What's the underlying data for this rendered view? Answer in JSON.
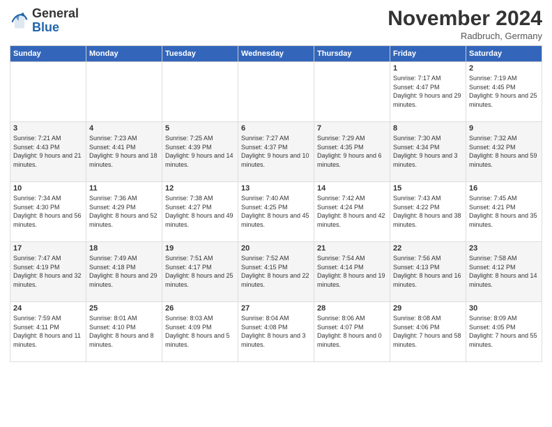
{
  "header": {
    "logo_general": "General",
    "logo_blue": "Blue",
    "title": "November 2024",
    "location": "Radbruch, Germany"
  },
  "days_of_week": [
    "Sunday",
    "Monday",
    "Tuesday",
    "Wednesday",
    "Thursday",
    "Friday",
    "Saturday"
  ],
  "weeks": [
    [
      {
        "day": "",
        "info": ""
      },
      {
        "day": "",
        "info": ""
      },
      {
        "day": "",
        "info": ""
      },
      {
        "day": "",
        "info": ""
      },
      {
        "day": "",
        "info": ""
      },
      {
        "day": "1",
        "info": "Sunrise: 7:17 AM\nSunset: 4:47 PM\nDaylight: 9 hours and 29 minutes."
      },
      {
        "day": "2",
        "info": "Sunrise: 7:19 AM\nSunset: 4:45 PM\nDaylight: 9 hours and 25 minutes."
      }
    ],
    [
      {
        "day": "3",
        "info": "Sunrise: 7:21 AM\nSunset: 4:43 PM\nDaylight: 9 hours and 21 minutes."
      },
      {
        "day": "4",
        "info": "Sunrise: 7:23 AM\nSunset: 4:41 PM\nDaylight: 9 hours and 18 minutes."
      },
      {
        "day": "5",
        "info": "Sunrise: 7:25 AM\nSunset: 4:39 PM\nDaylight: 9 hours and 14 minutes."
      },
      {
        "day": "6",
        "info": "Sunrise: 7:27 AM\nSunset: 4:37 PM\nDaylight: 9 hours and 10 minutes."
      },
      {
        "day": "7",
        "info": "Sunrise: 7:29 AM\nSunset: 4:35 PM\nDaylight: 9 hours and 6 minutes."
      },
      {
        "day": "8",
        "info": "Sunrise: 7:30 AM\nSunset: 4:34 PM\nDaylight: 9 hours and 3 minutes."
      },
      {
        "day": "9",
        "info": "Sunrise: 7:32 AM\nSunset: 4:32 PM\nDaylight: 8 hours and 59 minutes."
      }
    ],
    [
      {
        "day": "10",
        "info": "Sunrise: 7:34 AM\nSunset: 4:30 PM\nDaylight: 8 hours and 56 minutes."
      },
      {
        "day": "11",
        "info": "Sunrise: 7:36 AM\nSunset: 4:29 PM\nDaylight: 8 hours and 52 minutes."
      },
      {
        "day": "12",
        "info": "Sunrise: 7:38 AM\nSunset: 4:27 PM\nDaylight: 8 hours and 49 minutes."
      },
      {
        "day": "13",
        "info": "Sunrise: 7:40 AM\nSunset: 4:25 PM\nDaylight: 8 hours and 45 minutes."
      },
      {
        "day": "14",
        "info": "Sunrise: 7:42 AM\nSunset: 4:24 PM\nDaylight: 8 hours and 42 minutes."
      },
      {
        "day": "15",
        "info": "Sunrise: 7:43 AM\nSunset: 4:22 PM\nDaylight: 8 hours and 38 minutes."
      },
      {
        "day": "16",
        "info": "Sunrise: 7:45 AM\nSunset: 4:21 PM\nDaylight: 8 hours and 35 minutes."
      }
    ],
    [
      {
        "day": "17",
        "info": "Sunrise: 7:47 AM\nSunset: 4:19 PM\nDaylight: 8 hours and 32 minutes."
      },
      {
        "day": "18",
        "info": "Sunrise: 7:49 AM\nSunset: 4:18 PM\nDaylight: 8 hours and 29 minutes."
      },
      {
        "day": "19",
        "info": "Sunrise: 7:51 AM\nSunset: 4:17 PM\nDaylight: 8 hours and 25 minutes."
      },
      {
        "day": "20",
        "info": "Sunrise: 7:52 AM\nSunset: 4:15 PM\nDaylight: 8 hours and 22 minutes."
      },
      {
        "day": "21",
        "info": "Sunrise: 7:54 AM\nSunset: 4:14 PM\nDaylight: 8 hours and 19 minutes."
      },
      {
        "day": "22",
        "info": "Sunrise: 7:56 AM\nSunset: 4:13 PM\nDaylight: 8 hours and 16 minutes."
      },
      {
        "day": "23",
        "info": "Sunrise: 7:58 AM\nSunset: 4:12 PM\nDaylight: 8 hours and 14 minutes."
      }
    ],
    [
      {
        "day": "24",
        "info": "Sunrise: 7:59 AM\nSunset: 4:11 PM\nDaylight: 8 hours and 11 minutes."
      },
      {
        "day": "25",
        "info": "Sunrise: 8:01 AM\nSunset: 4:10 PM\nDaylight: 8 hours and 8 minutes."
      },
      {
        "day": "26",
        "info": "Sunrise: 8:03 AM\nSunset: 4:09 PM\nDaylight: 8 hours and 5 minutes."
      },
      {
        "day": "27",
        "info": "Sunrise: 8:04 AM\nSunset: 4:08 PM\nDaylight: 8 hours and 3 minutes."
      },
      {
        "day": "28",
        "info": "Sunrise: 8:06 AM\nSunset: 4:07 PM\nDaylight: 8 hours and 0 minutes."
      },
      {
        "day": "29",
        "info": "Sunrise: 8:08 AM\nSunset: 4:06 PM\nDaylight: 7 hours and 58 minutes."
      },
      {
        "day": "30",
        "info": "Sunrise: 8:09 AM\nSunset: 4:05 PM\nDaylight: 7 hours and 55 minutes."
      }
    ]
  ]
}
